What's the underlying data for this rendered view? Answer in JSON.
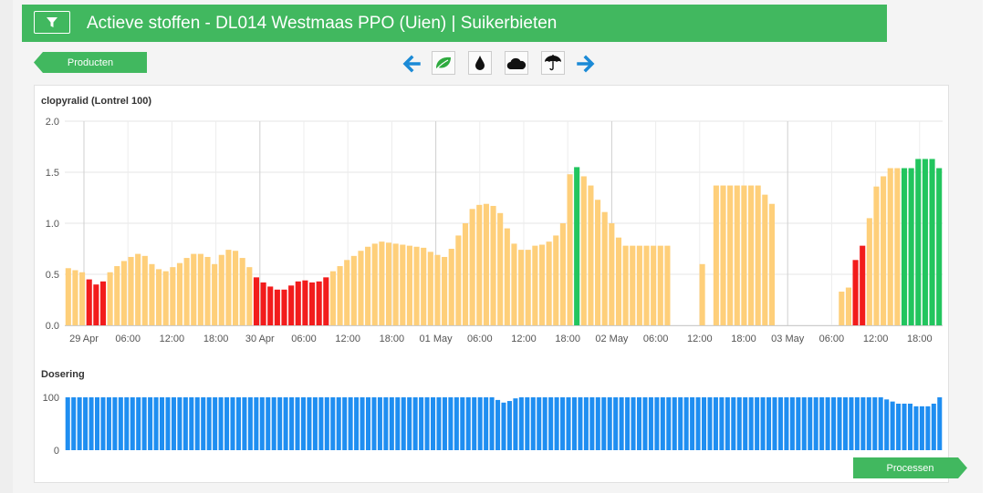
{
  "header": {
    "title": "Actieve stoffen - DL014 Westmaas PPO (Uien) | Suikerbieten"
  },
  "nav": {
    "producten_label": "Producten",
    "processen_label": "Processen"
  },
  "toolbar": {
    "icons": [
      "arrow-left-icon",
      "leaf-icon",
      "drop-icon",
      "cloud-icon",
      "umbrella-icon",
      "arrow-right-icon"
    ]
  },
  "colors": {
    "green": "#41b85f",
    "bar_green": "#22c55e",
    "bar_orange": "#fecf7a",
    "bar_red": "#f21c1c",
    "bar_blue": "#1f8ef1"
  },
  "chart_data": [
    {
      "type": "bar",
      "title": "clopyralid (Lontrel 100)",
      "ylim": [
        0,
        2.0
      ],
      "yticks": [
        "2.0",
        "1.5",
        "1.0",
        "0.5",
        "0.0"
      ],
      "xticks": [
        "29 Apr",
        "06:00",
        "12:00",
        "18:00",
        "30 Apr",
        "06:00",
        "12:00",
        "18:00",
        "01 May",
        "06:00",
        "12:00",
        "18:00",
        "02 May",
        "06:00",
        "12:00",
        "18:00",
        "03 May",
        "06:00",
        "12:00",
        "18:00"
      ],
      "grid": true,
      "values": [
        0.56,
        0.54,
        0.52,
        0.45,
        0.4,
        0.43,
        0.52,
        0.58,
        0.63,
        0.67,
        0.7,
        0.68,
        0.6,
        0.55,
        0.53,
        0.57,
        0.61,
        0.66,
        0.7,
        0.7,
        0.67,
        0.6,
        0.69,
        0.74,
        0.73,
        0.66,
        0.57,
        0.47,
        0.42,
        0.38,
        0.35,
        0.35,
        0.39,
        0.43,
        0.44,
        0.42,
        0.43,
        0.47,
        0.53,
        0.58,
        0.64,
        0.68,
        0.73,
        0.77,
        0.8,
        0.82,
        0.81,
        0.8,
        0.79,
        0.78,
        0.77,
        0.76,
        0.72,
        0.69,
        0.67,
        0.75,
        0.88,
        1.0,
        1.14,
        1.18,
        1.19,
        1.17,
        1.1,
        0.95,
        0.8,
        0.74,
        0.74,
        0.78,
        0.79,
        0.82,
        0.88,
        1.0,
        1.48,
        1.55,
        1.46,
        1.37,
        1.23,
        1.11,
        1.0,
        0.86,
        0.78,
        0.78,
        0.78,
        0.78,
        0.78,
        0.78,
        0.78,
        null,
        null,
        null,
        null,
        0.6,
        null,
        1.37,
        1.37,
        1.37,
        1.37,
        1.37,
        1.37,
        1.37,
        1.28,
        1.19,
        null,
        null,
        null,
        null,
        null,
        null,
        null,
        null,
        null,
        0.33,
        0.37,
        0.64,
        0.78,
        1.05,
        1.36,
        1.46,
        1.54,
        1.54,
        1.54,
        1.54,
        1.63,
        1.63,
        1.63,
        1.54
      ],
      "colors": [
        "o",
        "o",
        "o",
        "r",
        "r",
        "r",
        "o",
        "o",
        "o",
        "o",
        "o",
        "o",
        "o",
        "o",
        "o",
        "o",
        "o",
        "o",
        "o",
        "o",
        "o",
        "o",
        "o",
        "o",
        "o",
        "o",
        "o",
        "r",
        "r",
        "r",
        "r",
        "r",
        "r",
        "r",
        "r",
        "r",
        "r",
        "r",
        "o",
        "o",
        "o",
        "o",
        "o",
        "o",
        "o",
        "o",
        "o",
        "o",
        "o",
        "o",
        "o",
        "o",
        "o",
        "o",
        "o",
        "o",
        "o",
        "o",
        "o",
        "o",
        "o",
        "o",
        "o",
        "o",
        "o",
        "o",
        "o",
        "o",
        "o",
        "o",
        "o",
        "o",
        "o",
        "g",
        "o",
        "o",
        "o",
        "o",
        "o",
        "o",
        "o",
        "o",
        "o",
        "o",
        "o",
        "o",
        "o",
        "o",
        "o",
        "o",
        "o",
        "o",
        "o",
        "o",
        "o",
        "o",
        "o",
        "o",
        "o",
        "o",
        "o",
        "o",
        "o",
        "o",
        "o",
        "o",
        "o",
        "o",
        "o",
        "o",
        "o",
        "o",
        "o",
        "r",
        "r",
        "o",
        "o",
        "o",
        "o",
        "o",
        "g",
        "g",
        "g",
        "g",
        "g",
        "g",
        "g",
        "g"
      ]
    },
    {
      "type": "bar",
      "title": "Dosering",
      "ylim": [
        0,
        100
      ],
      "yticks": [
        "100",
        "0"
      ],
      "values": [
        100,
        100,
        100,
        100,
        100,
        100,
        100,
        100,
        100,
        100,
        100,
        100,
        100,
        100,
        100,
        100,
        100,
        100,
        100,
        100,
        100,
        100,
        100,
        100,
        100,
        100,
        100,
        100,
        100,
        100,
        100,
        100,
        100,
        100,
        100,
        100,
        100,
        100,
        100,
        100,
        100,
        100,
        100,
        100,
        100,
        100,
        100,
        100,
        100,
        100,
        100,
        100,
        100,
        100,
        100,
        100,
        100,
        100,
        100,
        100,
        100,
        100,
        100,
        100,
        100,
        100,
        100,
        100,
        100,
        100,
        100,
        100,
        100,
        95,
        90,
        93,
        98,
        100,
        100,
        100,
        100,
        100,
        100,
        100,
        100,
        100,
        100,
        100,
        100,
        100,
        100,
        100,
        100,
        100,
        100,
        100,
        100,
        100,
        100,
        100,
        100,
        100,
        100,
        100,
        100,
        100,
        100,
        100,
        100,
        100,
        100,
        100,
        100,
        100,
        100,
        100,
        100,
        100,
        100,
        100,
        100,
        100,
        100,
        100,
        100,
        100,
        100,
        100,
        100,
        100,
        100,
        100,
        100,
        100,
        100,
        100,
        100,
        100,
        100,
        96,
        92,
        88,
        88,
        88,
        83,
        83,
        83,
        88,
        100
      ]
    }
  ]
}
